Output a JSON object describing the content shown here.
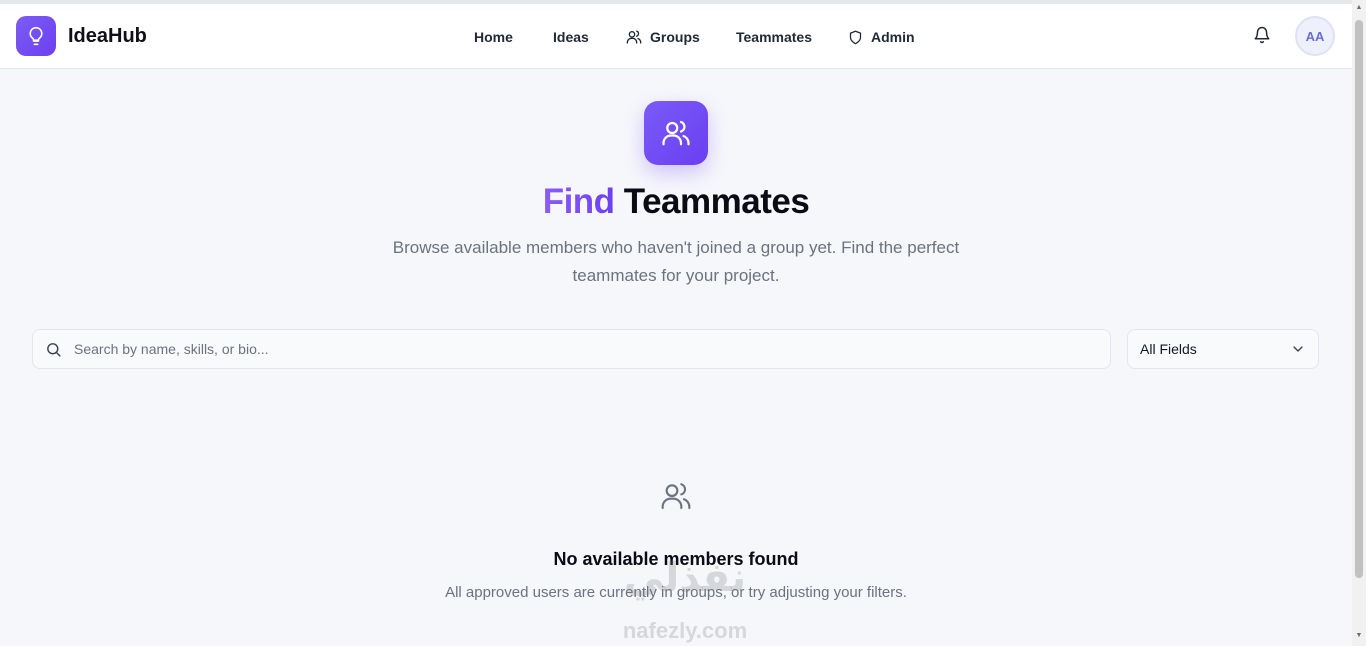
{
  "app": {
    "name": "IdeaHub"
  },
  "nav": {
    "items": [
      {
        "label": "Home",
        "icon": ""
      },
      {
        "label": "Ideas",
        "icon": ""
      },
      {
        "label": "Groups",
        "icon": "users-icon"
      },
      {
        "label": "Teammates",
        "icon": ""
      },
      {
        "label": "Admin",
        "icon": "shield-icon"
      }
    ]
  },
  "header": {
    "avatar_initials": "AA",
    "bell_icon": "bell-icon"
  },
  "hero": {
    "icon": "users-icon",
    "title_accent": "Find",
    "title_rest": "Teammates",
    "subtitle": "Browse available members who haven't joined a group yet. Find the perfect teammates for your project."
  },
  "search": {
    "placeholder": "Search by name, skills, or bio...",
    "value": ""
  },
  "filter": {
    "selected": "All Fields"
  },
  "empty_state": {
    "icon": "users-icon",
    "title": "No available members found",
    "message": "All approved users are currently in groups, or try adjusting your filters."
  },
  "watermark": {
    "arabic": "نفذلي",
    "url": "nafezly.com"
  },
  "colors": {
    "accent": "#6d3ff0",
    "accent_light": "#8b5cf6",
    "text_muted": "#6b7280"
  }
}
